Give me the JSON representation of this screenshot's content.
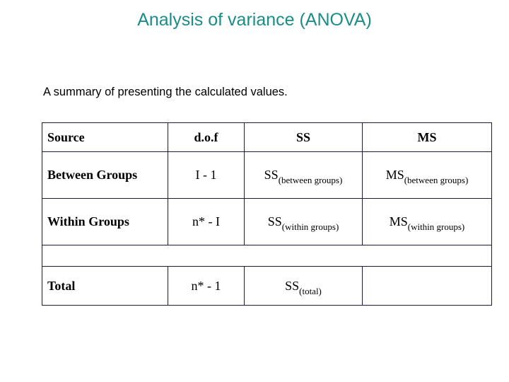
{
  "title": "Analysis of variance (ANOVA)",
  "subtitle": "A summary of presenting the calculated values.",
  "colors": {
    "title": "#1a8c8a",
    "border": "#1a1a40",
    "text": "#000000"
  },
  "table": {
    "headers": [
      "Source",
      "d.o.f",
      "SS",
      "MS"
    ],
    "rows": [
      {
        "source": "Between Groups",
        "dof": "I - 1",
        "ss": {
          "main": "SS",
          "sub": "(between groups)"
        },
        "ms": {
          "main": "MS",
          "sub": "(between groups)"
        }
      },
      {
        "source": "Within Groups",
        "dof": "n* - I",
        "ss": {
          "main": "SS",
          "sub": "(within groups)"
        },
        "ms": {
          "main": "MS",
          "sub": "(within groups)"
        }
      },
      {
        "source": "Total",
        "dof": "n* - 1",
        "ss": {
          "main": "SS",
          "sub": "(total)"
        },
        "ms": {
          "main": "",
          "sub": ""
        }
      }
    ]
  }
}
